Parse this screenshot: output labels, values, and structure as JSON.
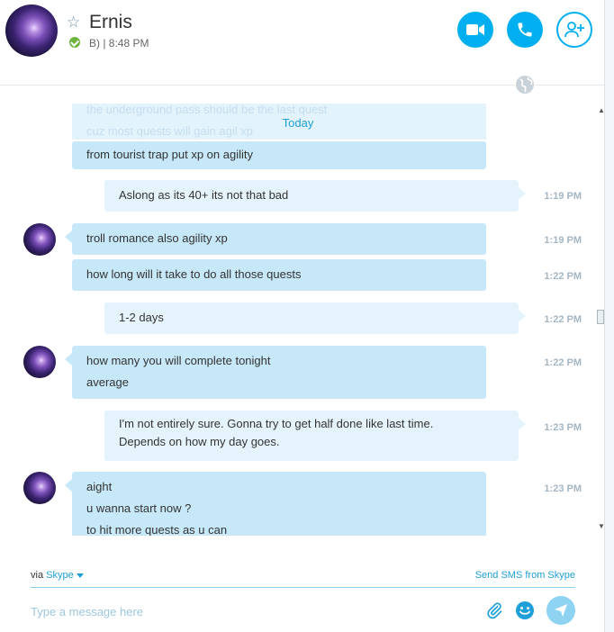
{
  "contact": {
    "name": "Ernis",
    "status_text": "B) | 8:48 PM"
  },
  "icons": {
    "star": "star-icon",
    "presence": "online-check-icon",
    "video": "video-camera-icon",
    "call": "phone-icon",
    "add": "add-contact-icon",
    "globe": "globe-icon",
    "attach": "paperclip-icon",
    "emoji": "emoji-icon",
    "send": "send-icon"
  },
  "colors": {
    "accent": "#00aff0",
    "incoming_bubble": "#c7e8f8",
    "outgoing_bubble": "#e5f4fc",
    "online": "#6cb33f"
  },
  "chat": {
    "ghost_lines": [
      "the underground pass should be the last quest",
      "cuz most quests will gain agil xp"
    ],
    "date_divider": "Today",
    "messages": [
      {
        "dir": "in",
        "lines": [
          "from tourist trap put xp on agility"
        ],
        "time": ""
      },
      {
        "dir": "out",
        "lines": [
          "Aslong as its 40+ its not that bad"
        ],
        "time": "1:19 PM"
      },
      {
        "dir": "in",
        "lines": [
          "troll romance also agility xp"
        ],
        "time": "1:19 PM"
      },
      {
        "dir": "in",
        "lines": [
          "how long will it take to do all those quests"
        ],
        "time": "1:22 PM"
      },
      {
        "dir": "out",
        "lines": [
          "1-2 days"
        ],
        "time": "1:22 PM"
      },
      {
        "dir": "in",
        "lines": [
          "how many you will complete tonight",
          "average"
        ],
        "time": "1:22 PM"
      },
      {
        "dir": "out",
        "lines": [
          "I'm not entirely sure. Gonna try to get half done like last time.",
          "Depends on how my day goes."
        ],
        "time": "1:23 PM"
      },
      {
        "dir": "in",
        "lines": [
          "aight",
          "u wanna start now ?",
          "to hit more quests as u can"
        ],
        "time": "1:23 PM"
      }
    ]
  },
  "footer": {
    "via_label": "via",
    "via_service": "Skype",
    "sms_link": "Send SMS from Skype",
    "input_placeholder": "Type a message here",
    "input_value": ""
  }
}
